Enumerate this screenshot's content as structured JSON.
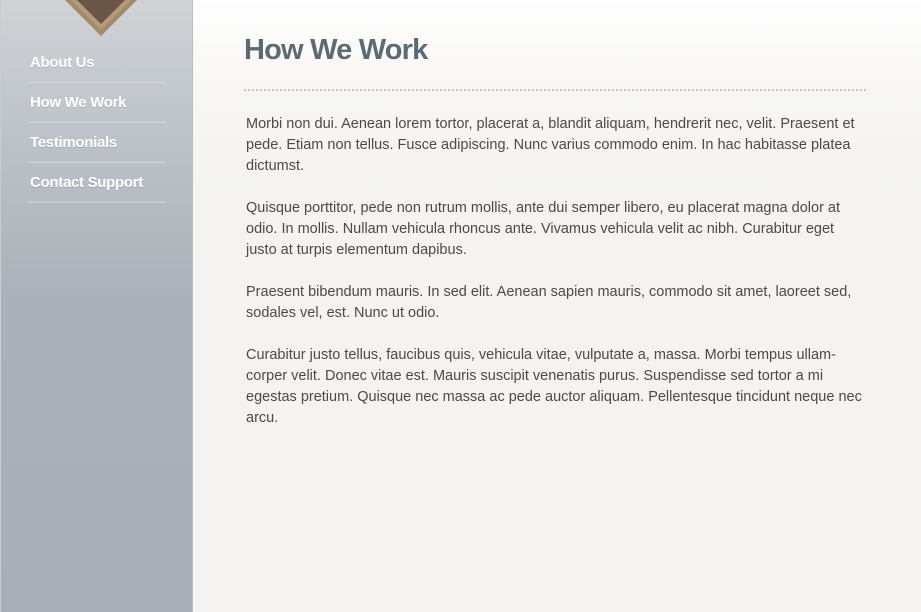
{
  "colors": {
    "title": "#5c6b72",
    "body_text": "#4a4a4a",
    "nav_text": "#ffffff",
    "sidebar_top": "#cfd3d6",
    "sidebar_bottom": "#a9aeb6",
    "logo_outer": "#a48a6b",
    "logo_inner": "#6a5646"
  },
  "sidebar": {
    "logo_icon": "diamond-logo-icon",
    "items": [
      {
        "label": "About Us"
      },
      {
        "label": "How We Work"
      },
      {
        "label": "Testimonials"
      },
      {
        "label": "Contact Support"
      }
    ]
  },
  "main": {
    "title": "How We Work",
    "paragraphs": [
      "Morbi non dui. Aenean lorem tortor, placerat a, blandit aliquam, hendrerit nec, velit. Praesent et pede. Etiam non tellus. Fusce adipiscing. Nunc varius commodo enim. In hac habitasse platea dictumst.",
      "Quisque porttitor, pede non rutrum mollis, ante dui semper libero, eu placerat magna dolor at odio. In mollis. Nullam vehicula rhoncus ante. Vivamus vehicula velit ac nibh. Curabitur eget justo at turpis elementum dapibus.",
      "Praesent bibendum mauris. In sed elit. Aenean sapien mauris, commodo sit amet, laoreet sed, sodales vel, est. Nunc ut odio.",
      "Curabitur justo tellus, faucibus quis, vehicula vitae, vulputate a, massa. Morbi tempus ullam-corper velit. Donec vitae est. Mauris suscipit venenatis purus. Suspendisse sed tortor a mi egestas pretium. Quisque nec massa ac pede auctor aliquam. Pellentesque tincidunt neque nec arcu."
    ]
  }
}
